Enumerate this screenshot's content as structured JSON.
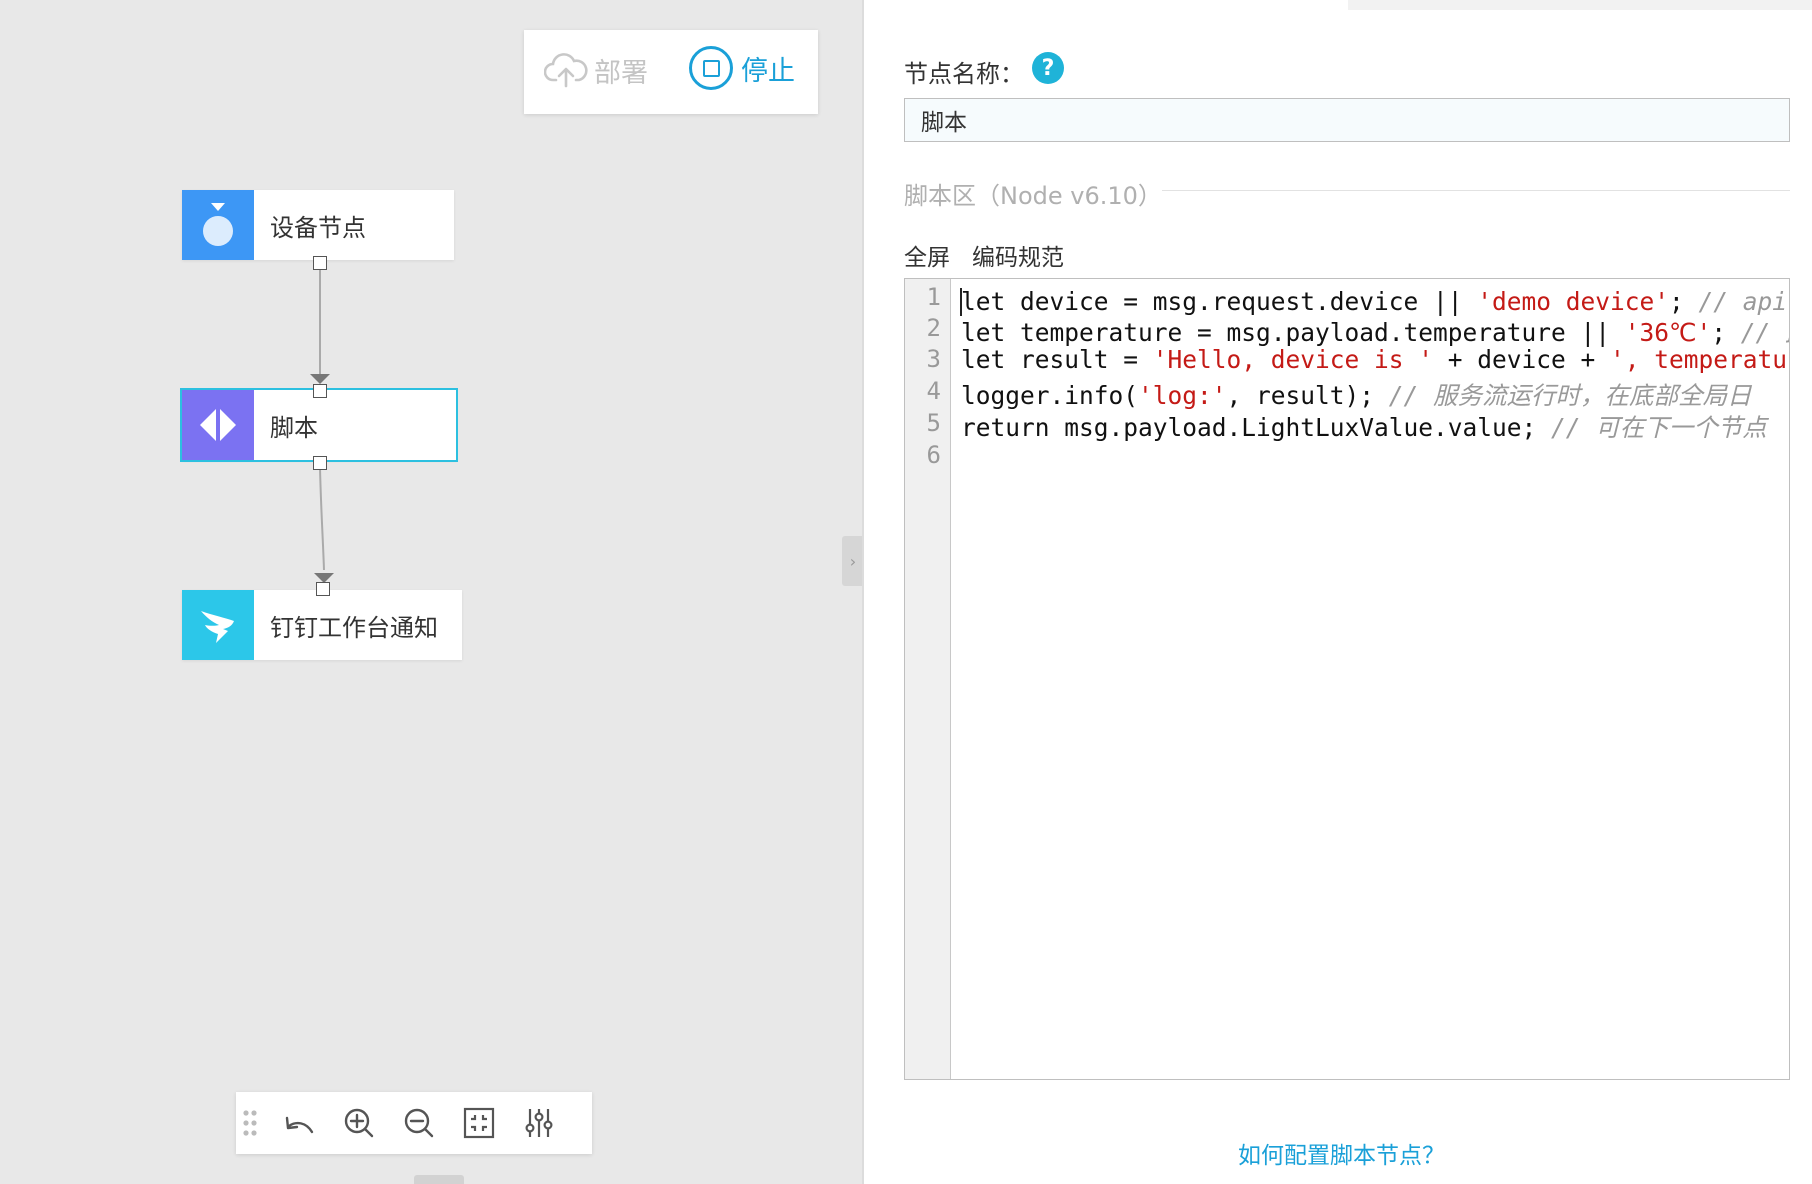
{
  "toolbar": {
    "deploy_label": "部署",
    "stop_label": "停止"
  },
  "nodes": [
    {
      "label": "设备节点",
      "icon": "device-node-icon",
      "color": "#3d97f5"
    },
    {
      "label": "脚本",
      "icon": "script-node-icon",
      "color": "#7b72f2"
    },
    {
      "label": "钉钉工作台通知",
      "icon": "dingtalk-icon",
      "color": "#2cc7e9"
    }
  ],
  "canvas_tools": [
    "drag-handle-icon",
    "undo-icon",
    "zoom-in-icon",
    "zoom-out-icon",
    "fit-view-icon",
    "settings-sliders-icon"
  ],
  "panel": {
    "name_label": "节点名称：",
    "help_glyph": "?",
    "name_value": "脚本",
    "script_section": "脚本区（Node v6.10）",
    "fullscreen_link": "全屏",
    "coding_rules_link": "编码规范",
    "help_link": "如何配置脚本节点？"
  },
  "code": {
    "line_numbers": [
      "1",
      "2",
      "3",
      "4",
      "5",
      "6"
    ],
    "lines": [
      [
        "let device = msg.request.device || ",
        "'demo device'",
        "; ",
        "// api输"
      ],
      [
        "let temperature = msg.payload.temperature || ",
        "'36℃'",
        "; ",
        "// 此"
      ],
      [
        "let result = ",
        "'Hello, device is '",
        " + device + ",
        "', temperature"
      ],
      [
        "logger.info(",
        "'log:'",
        ", result); ",
        "// 服务流运行时，在底部全局日"
      ],
      [
        "return msg.payload.LightLuxValue.value; ",
        "",
        "",
        "// 可在下一个节点"
      ]
    ]
  },
  "colors": {
    "accent": "#1aa0d8",
    "selected_outline": "#2cc0e0",
    "string": "#c41a16",
    "comment": "#999999"
  }
}
